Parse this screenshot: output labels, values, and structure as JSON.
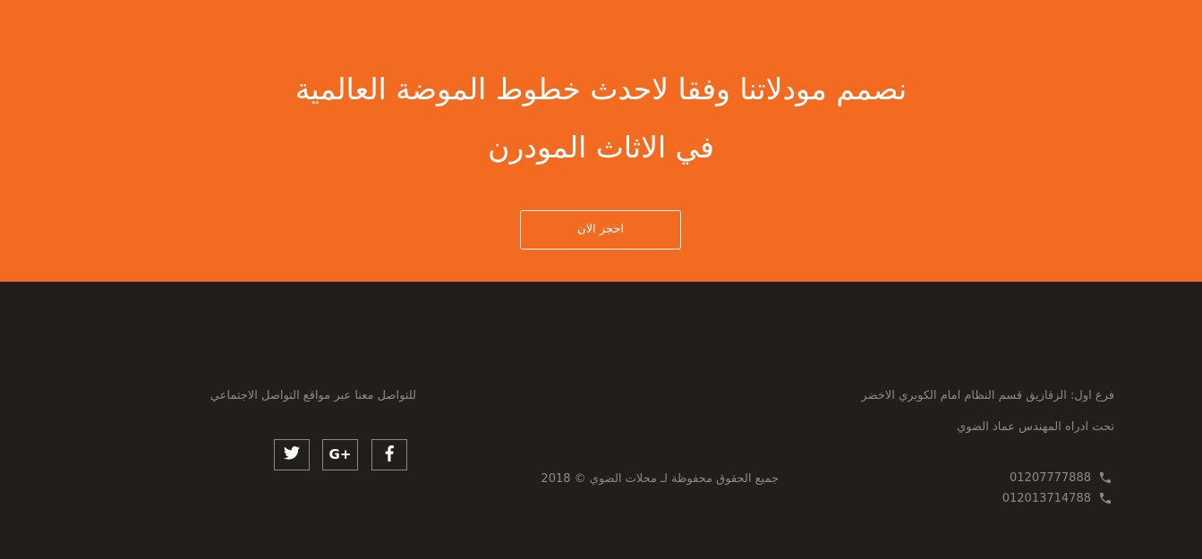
{
  "hero": {
    "headline_line1": "نصمم مودلاتنا وفقا لاحدث خطوط الموضة العالمية",
    "headline_line2": "في الاثاث المودرن",
    "cta_label": "احجز الان",
    "background_color": "#f26b21"
  },
  "footer": {
    "background_color": "#221e1b",
    "text_color": "#8d8a86",
    "social_label": "للتواصل معنا عبر مواقع التواصل الاجتماعي",
    "social_icons": [
      "twitter-icon",
      "google-plus-icon",
      "facebook-icon"
    ],
    "branch_address": "فرع اول: الزقازيق قسم النظام امام الكوبري الاخضر",
    "manager": "تحت ادراه المهندس عماد الضوي",
    "copyright": "جميع الحقوق محفوظة لـ محلات الضوي © 2018",
    "phones": [
      "01207777888",
      "012013714788"
    ],
    "phone_icon": "phone-icon"
  }
}
